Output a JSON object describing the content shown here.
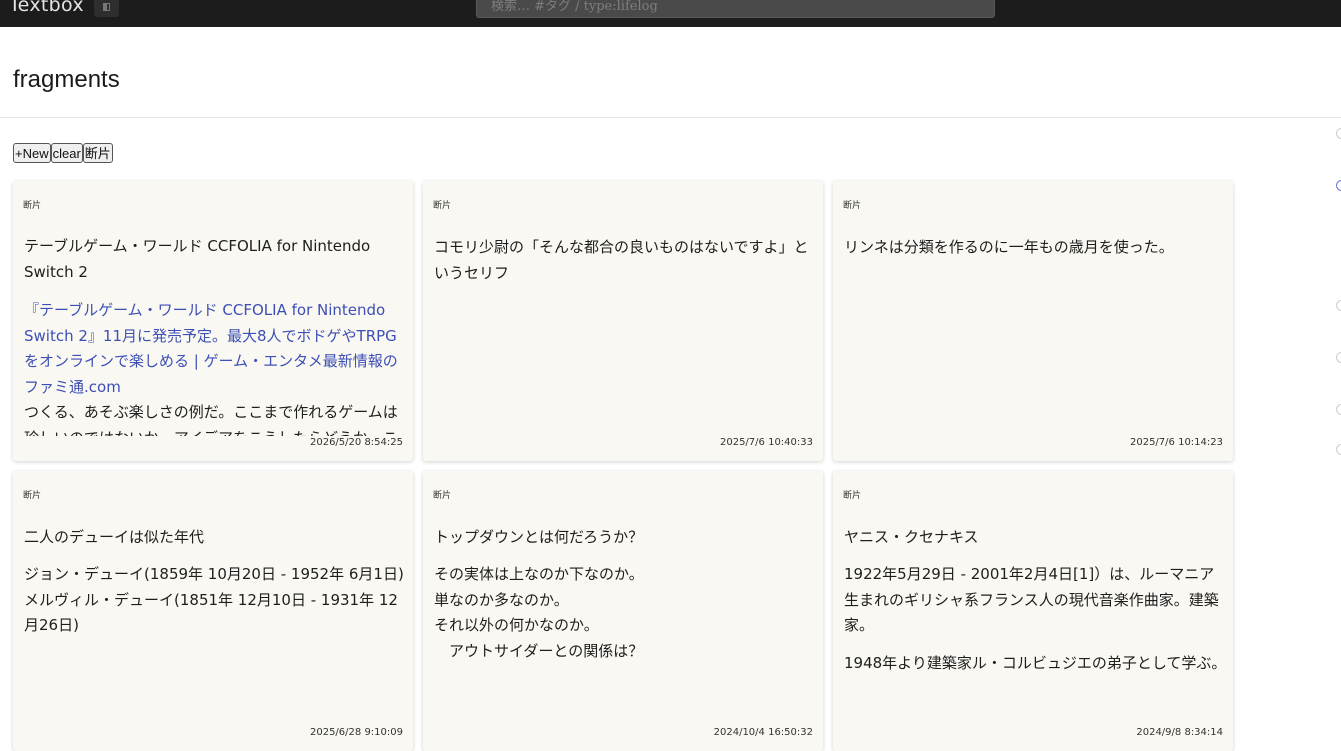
{
  "app": {
    "title": "Textbox",
    "search_placeholder": "検索… #タグ / type:lifelog"
  },
  "page": {
    "title": "fragments"
  },
  "toolbar": {
    "new_label": "+New",
    "clear_label": "clear",
    "filter_label": "断片"
  },
  "cards": [
    {
      "tag": "断片",
      "title": "テーブルゲーム・ワールド CCFOLIA for Nintendo Switch 2",
      "link": "『テーブルゲーム・ワールド CCFOLIA for Nintendo Switch 2』11月に発売予定。最大8人でボドゲやTRPGをオンラインで楽しめる | ゲーム・エンタメ最新情報のファミ通.com",
      "body": "つくる、あそぶ楽しさの例だ。ここまで作れるゲームは珍しいのではないか。アイデアをこうしたらどうか、これならどうなるか…",
      "date": "2026/5/20 8:54:25"
    },
    {
      "tag": "断片",
      "title": "コモリ少尉の「そんな都合の良いものはないですよ」というセリフ",
      "date": "2025/7/6 10:40:33"
    },
    {
      "tag": "断片",
      "title": "リンネは分類を作るのに一年もの歳月を使った。",
      "date": "2025/7/6 10:14:23"
    },
    {
      "tag": "断片",
      "title": "二人のデューイは似た年代",
      "lines": [
        "ジョン・デューイ(1859年 10月20日 - 1952年 6月1日)",
        "メルヴィル・デューイ(1851年 12月10日 - 1931年 12月26日)"
      ],
      "date": "2025/6/28 9:10:09"
    },
    {
      "tag": "断片",
      "title": "トップダウンとは何だろうか？",
      "lines": [
        "その実体は上なのか下なのか。",
        "単なのか多なのか。",
        "それ以外の何かなのか。",
        "　アウトサイダーとの関係は？"
      ],
      "date": "2024/10/4 16:50:32"
    },
    {
      "tag": "断片",
      "title": "ヤニス・クセナキス",
      "paragraphs": [
        "1922年5月29日 - 2001年2月4日[1]）は、ルーマニア生まれのギリシャ系フランス人の現代音楽作曲家。建築家。",
        "1948年より建築家ル・コルビュジエの弟子として学ぶ。"
      ],
      "date": "2024/9/8 8:34:14"
    }
  ]
}
